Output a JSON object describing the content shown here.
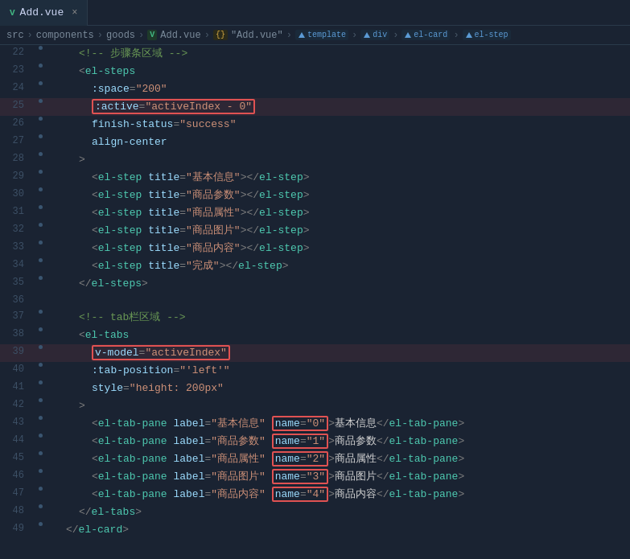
{
  "tab": {
    "filename": "Add.vue",
    "close_label": "×"
  },
  "breadcrumb": {
    "items": [
      "src",
      "components",
      "goods",
      "Add.vue",
      "\"Add.vue\"",
      "template",
      "div",
      "el-card",
      "el-step"
    ]
  },
  "editor": {
    "lines": [
      {
        "num": 22,
        "content": "comment_steps_area"
      },
      {
        "num": 23,
        "content": "el_steps_open"
      },
      {
        "num": 24,
        "content": "attr_space"
      },
      {
        "num": 25,
        "content": "attr_active_highlighted"
      },
      {
        "num": 26,
        "content": "attr_finish_status"
      },
      {
        "num": 27,
        "content": "attr_align_center"
      },
      {
        "num": 28,
        "content": "close_bracket"
      },
      {
        "num": 29,
        "content": "el_step_1"
      },
      {
        "num": 30,
        "content": "el_step_2"
      },
      {
        "num": 31,
        "content": "el_step_3"
      },
      {
        "num": 32,
        "content": "el_step_4"
      },
      {
        "num": 33,
        "content": "el_step_5"
      },
      {
        "num": 34,
        "content": "el_step_6"
      },
      {
        "num": 35,
        "content": "el_steps_close"
      },
      {
        "num": 36,
        "content": "empty"
      },
      {
        "num": 37,
        "content": "comment_tab_area"
      },
      {
        "num": 38,
        "content": "el_tabs_open"
      },
      {
        "num": 39,
        "content": "attr_vmodel_highlighted"
      },
      {
        "num": 40,
        "content": "attr_tab_position"
      },
      {
        "num": 41,
        "content": "attr_style"
      },
      {
        "num": 42,
        "content": "close_bracket2"
      },
      {
        "num": 43,
        "content": "el_tab_pane_1"
      },
      {
        "num": 44,
        "content": "el_tab_pane_2"
      },
      {
        "num": 45,
        "content": "el_tab_pane_3"
      },
      {
        "num": 46,
        "content": "el_tab_pane_4"
      },
      {
        "num": 47,
        "content": "el_tab_pane_5"
      },
      {
        "num": 48,
        "content": "el_tabs_close"
      }
    ]
  }
}
